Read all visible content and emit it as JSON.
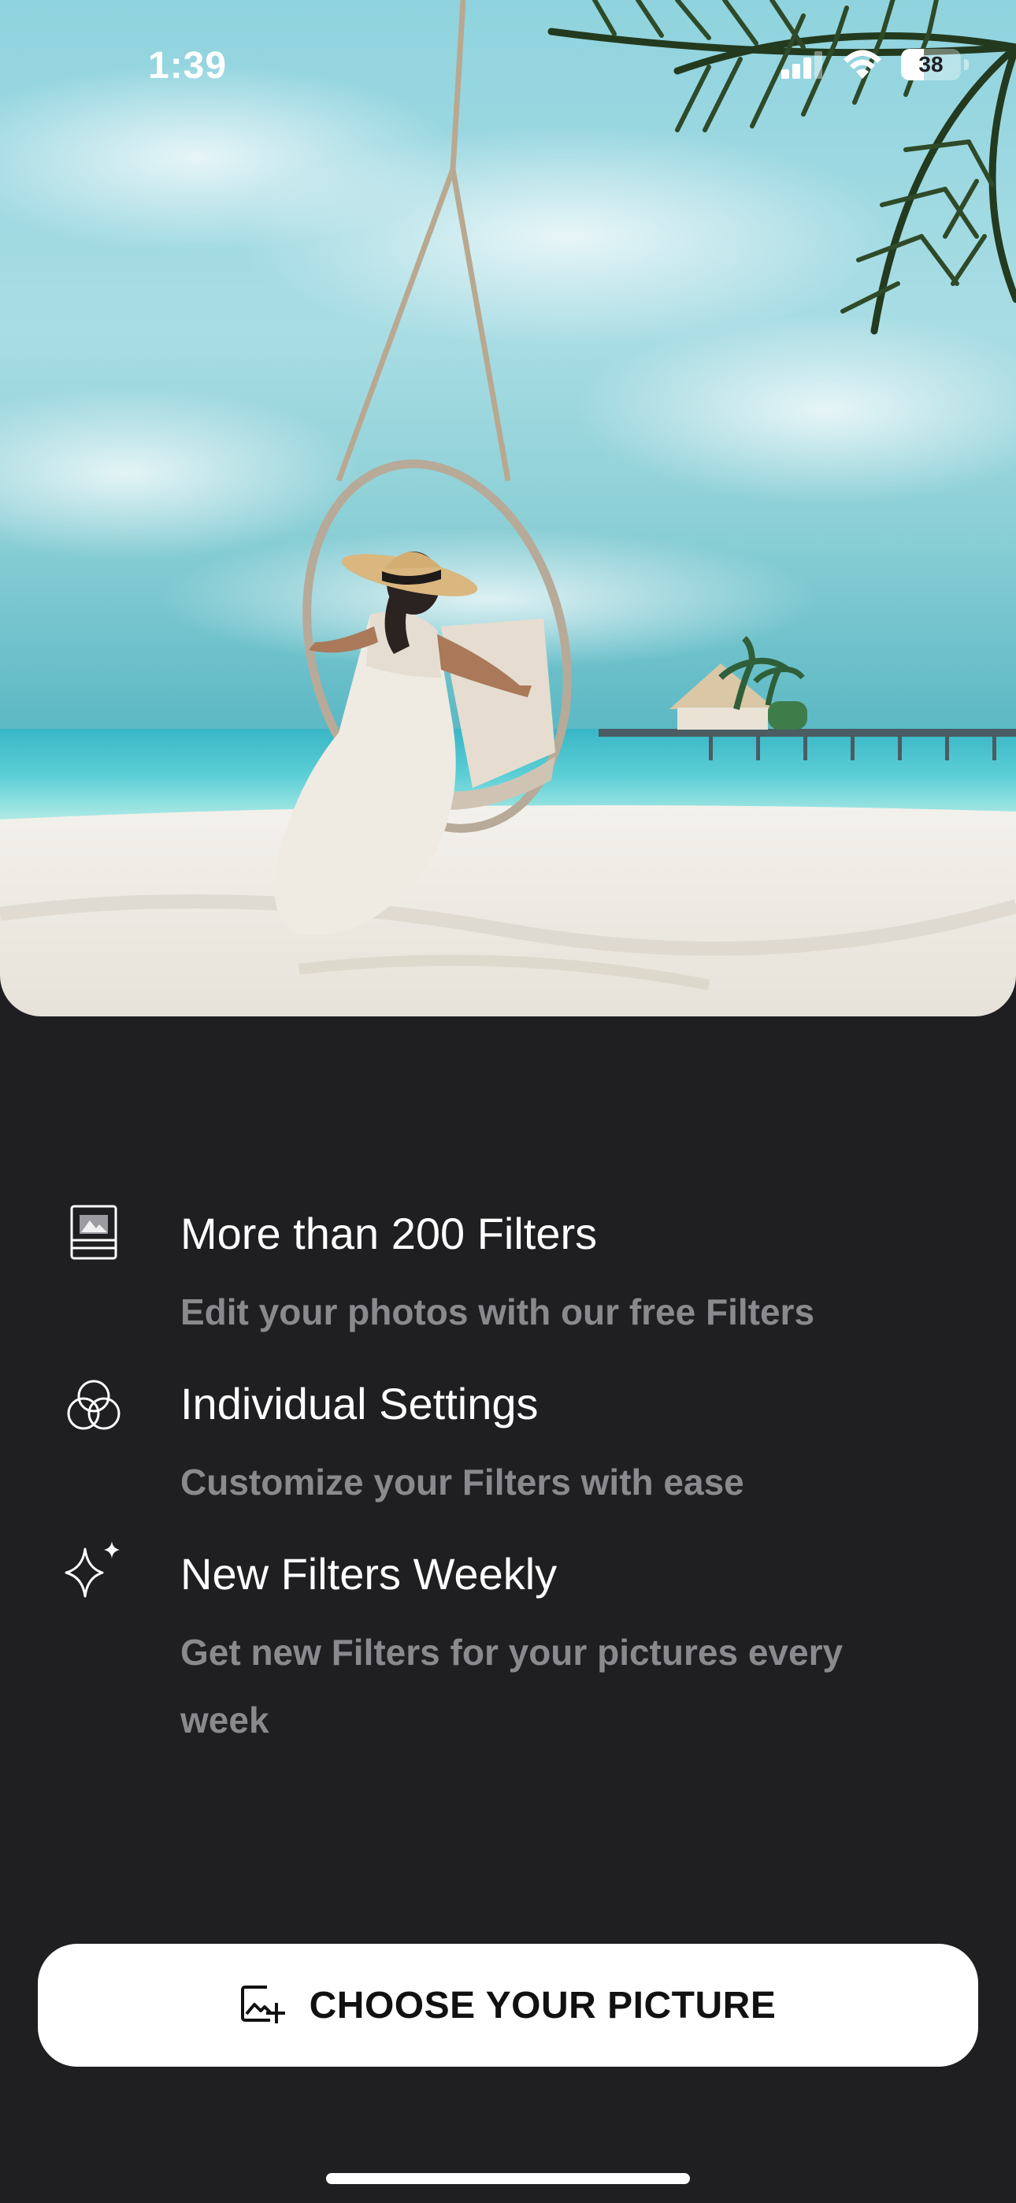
{
  "status_bar": {
    "time": "1:39",
    "battery_level": "38",
    "battery_fraction": 0.38
  },
  "hero": {
    "icon": "beach-swing-photo"
  },
  "features": [
    {
      "icon": "image-frame-icon",
      "title": "More than 200 Filters",
      "description": "Edit your photos with our free Filters"
    },
    {
      "icon": "color-circles-icon",
      "title": "Individual Settings",
      "description": "Customize your Filters with ease"
    },
    {
      "icon": "sparkle-icon",
      "title": "New Filters Weekly",
      "description": "Get new Filters for your pictures every week"
    }
  ],
  "cta": {
    "label": "CHOOSE YOUR PICTURE",
    "icon": "add-photo-icon"
  },
  "colors": {
    "background": "#1f1f21",
    "title": "#ffffff",
    "description": "#8a8a8e",
    "button": "#ffffff",
    "button_text": "#111111"
  }
}
